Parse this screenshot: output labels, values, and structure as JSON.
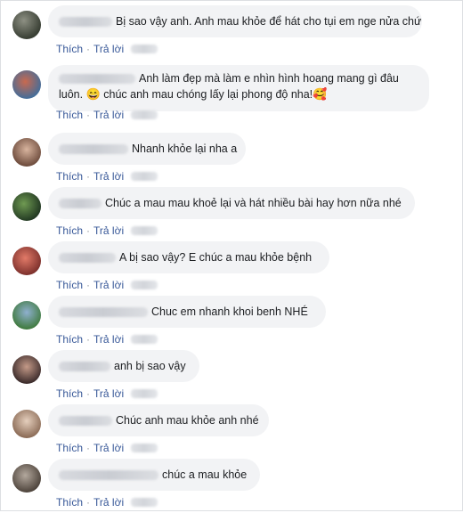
{
  "actions": {
    "like": "Thích",
    "reply": "Trả lời",
    "separator": "·"
  },
  "comments": [
    {
      "text": "Bị sao vậy anh. Anh mau khỏe để hát cho tụi em nge nửa chứ",
      "avatar_colors": [
        "#6b6e63",
        "#2f3a2c"
      ]
    },
    {
      "text_line1": "Anh làm đẹp mà làm e nhìn hình hoang mang gì đâu",
      "text_line2_pre": "luôn.",
      "emoji1": "😄",
      "text_line2_mid": "chúc anh mau chóng lấy lại phong độ nha!",
      "emoji2": "🥰",
      "avatar_colors": [
        "#b84a3a",
        "#3f6d9c"
      ]
    },
    {
      "text": "Nhanh khỏe lại nha a",
      "avatar_colors": [
        "#c9a089",
        "#6c4a3b"
      ]
    },
    {
      "text": "Chúc a mau mau khoẻ lại và hát nhiều bài hay hơn nữa nhé",
      "avatar_colors": [
        "#4e7a3a",
        "#1f3520"
      ]
    },
    {
      "text": "A bị sao vậy? E chúc a mau khỏe bệnh",
      "avatar_colors": [
        "#d35c4a",
        "#7a2e2a"
      ]
    },
    {
      "text": "Chuc em nhanh khoi benh NHÉ",
      "avatar_colors": [
        "#6b8fb0",
        "#3f7a3d"
      ]
    },
    {
      "text": "anh bị sao vậy",
      "avatar_colors": [
        "#b08a7a",
        "#3a2a2a"
      ]
    },
    {
      "text": "Chúc anh mau khỏe anh nhé",
      "avatar_colors": [
        "#d9c2b0",
        "#8a6a55"
      ]
    },
    {
      "text": "chúc a mau khỏe",
      "avatar_colors": [
        "#9a8f85",
        "#4a4038"
      ]
    }
  ]
}
